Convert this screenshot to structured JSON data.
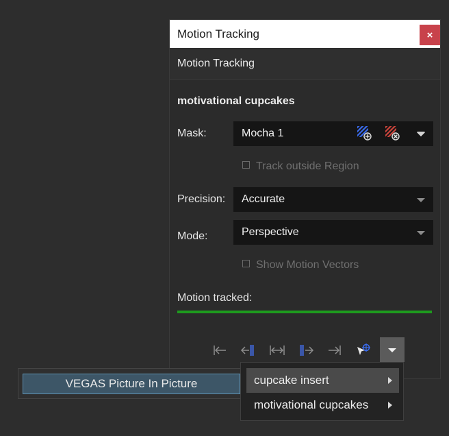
{
  "window": {
    "title": "Motion Tracking",
    "close_glyph": "×"
  },
  "header": {
    "title": "Motion Tracking"
  },
  "section": {
    "title": "motivational cupcakes"
  },
  "mask": {
    "label": "Mask:",
    "value": "Mocha 1",
    "add_icon": "add-mask-icon",
    "remove_icon": "remove-mask-icon",
    "more_icon": "chevron-down-icon"
  },
  "track_outside": {
    "label": "Track outside Region",
    "checked": false
  },
  "precision": {
    "label": "Precision:",
    "value": "Accurate"
  },
  "mode": {
    "label": "Mode:",
    "value": "Perspective"
  },
  "motion_vectors": {
    "label": "Show Motion Vectors",
    "checked": false
  },
  "progress": {
    "label": "Motion tracked:",
    "fraction": 1.0,
    "color": "#1e9b1e"
  },
  "transport": {
    "icons": [
      "go-to-start-icon",
      "track-backward-one-frame-icon",
      "track-both-directions-icon",
      "track-forward-one-frame-icon",
      "go-to-end-icon",
      "track-cursor-icon"
    ],
    "more_icon": "chevron-down-icon"
  },
  "pip_button": {
    "label": "VEGAS Picture In Picture"
  },
  "menu": {
    "items": [
      {
        "label": "cupcake insert",
        "has_submenu": true,
        "highlighted": true
      },
      {
        "label": "motivational cupcakes",
        "has_submenu": true,
        "highlighted": false
      }
    ]
  },
  "colors": {
    "accent_blue": "#3a6cf0",
    "accent_red": "#d0453d",
    "close_red": "#c8424b"
  }
}
